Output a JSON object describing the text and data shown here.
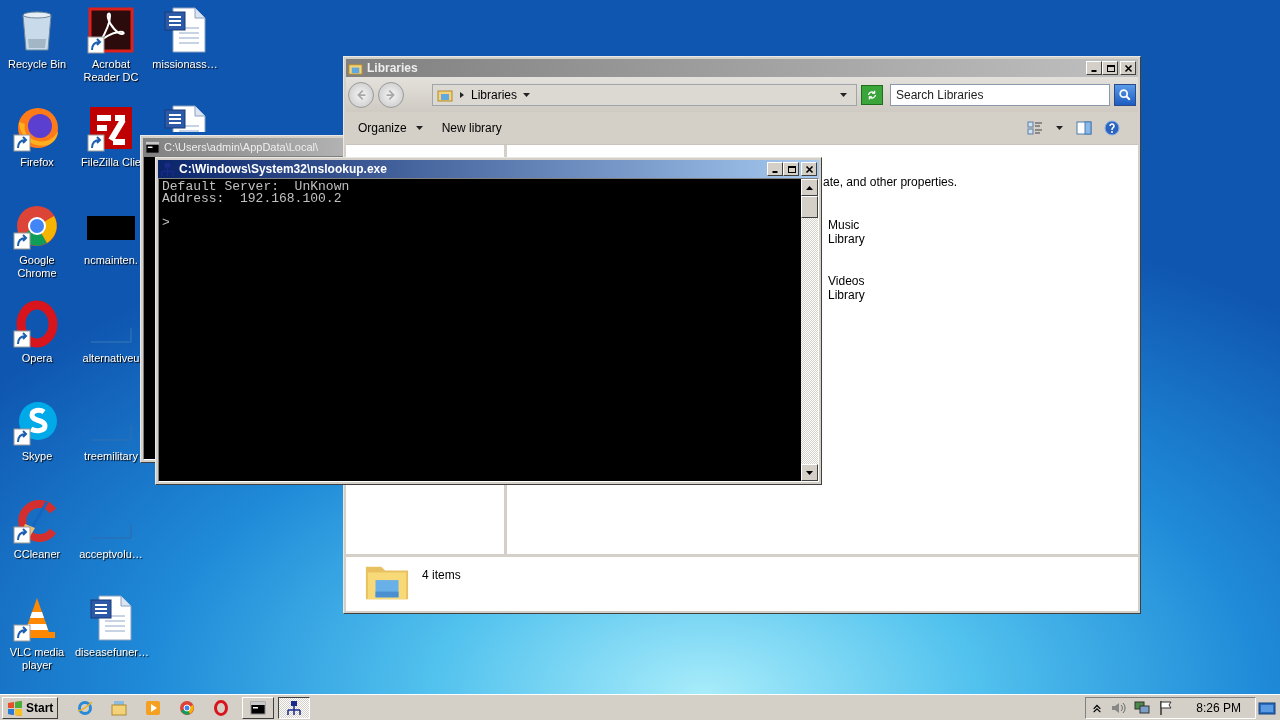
{
  "desktop": {
    "icons": [
      {
        "kind": "recycle-bin",
        "label": "Recycle Bin",
        "shortcut": false
      },
      {
        "kind": "firefox",
        "label": "Firefox",
        "shortcut": true
      },
      {
        "kind": "chrome",
        "label": "Google Chrome",
        "shortcut": true
      },
      {
        "kind": "opera",
        "label": "Opera",
        "shortcut": true
      },
      {
        "kind": "skype",
        "label": "Skype",
        "shortcut": true
      },
      {
        "kind": "ccleaner",
        "label": "CCleaner",
        "shortcut": true
      },
      {
        "kind": "vlc",
        "label": "VLC media player",
        "shortcut": true
      },
      {
        "kind": "pdf",
        "label": "Acrobat Reader DC",
        "shortcut": true
      },
      {
        "kind": "filezilla",
        "label": "FileZilla Clie",
        "shortcut": true
      },
      {
        "kind": "black-file",
        "label": "ncmainten.",
        "shortcut": false
      },
      {
        "kind": "blank-file",
        "label": "alternativeu",
        "shortcut": false
      },
      {
        "kind": "blank-file",
        "label": "treemilitary",
        "shortcut": false
      },
      {
        "kind": "blank-file",
        "label": "acceptvolu…",
        "shortcut": false
      },
      {
        "kind": "word",
        "label": "diseasefuner…",
        "shortcut": false
      },
      {
        "kind": "word",
        "label": "missionass…",
        "shortcut": false
      },
      {
        "kind": "word"
      }
    ]
  },
  "windows": [
    {
      "kind": "console",
      "title": "C:\\Users\\admin\\AppData\\Local\\",
      "active": false
    },
    {
      "kind": "explorer",
      "title": "Libraries",
      "active": false,
      "caption_buttons": true,
      "address": {
        "crumb": "Libraries"
      },
      "search": {
        "placeholder": "Search Libraries"
      },
      "toolbar": [
        {
          "label": "Organize",
          "menu": true
        },
        {
          "label": "New library",
          "menu": false
        }
      ],
      "content": {
        "description": "ate, and other properties.",
        "items": [
          {
            "label": "Music Library"
          },
          {
            "label": "Videos Library"
          }
        ]
      },
      "details": {
        "summary": "4 items"
      }
    },
    {
      "kind": "console",
      "title": "C:\\Windows\\System32\\nslookup.exe",
      "active": true,
      "caption_buttons": true,
      "output": [
        "Default Server:  UnKnown",
        "Address:  192.168.100.2"
      ],
      "prompt": ">"
    }
  ],
  "taskbar": {
    "start": "Start",
    "quick_launch": [
      {
        "kind": "ie"
      },
      {
        "kind": "explorer"
      },
      {
        "kind": "media"
      },
      {
        "kind": "chrome"
      },
      {
        "kind": "opera"
      }
    ],
    "window_buttons": [
      {
        "kind": "console",
        "selected": false
      },
      {
        "kind": "nslookup",
        "selected": true
      }
    ],
    "clock": "8:26 PM"
  }
}
